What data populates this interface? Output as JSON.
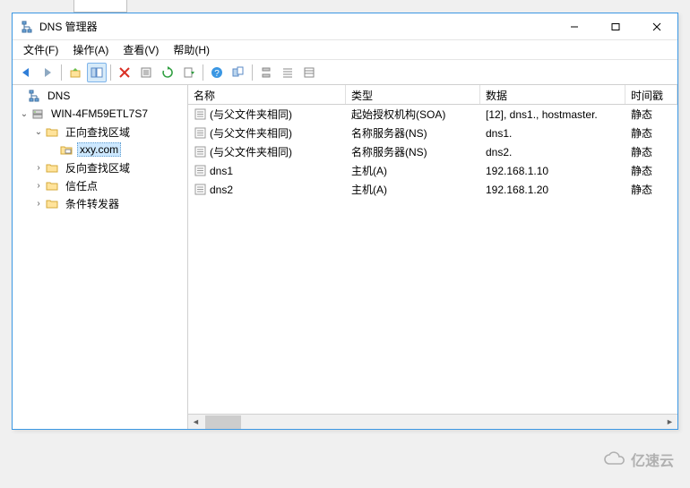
{
  "window": {
    "title": "DNS 管理器"
  },
  "menu": {
    "file": "文件(F)",
    "action": "操作(A)",
    "view": "查看(V)",
    "help": "帮助(H)"
  },
  "tree": {
    "root": "DNS",
    "server": "WIN-4FM59ETL7S7",
    "fwd_zone": "正向查找区域",
    "selected_zone": "xxy.com",
    "rev_zone": "反向查找区域",
    "trust": "信任点",
    "cond_fwd": "条件转发器"
  },
  "columns": {
    "name": "名称",
    "type": "类型",
    "data": "数据",
    "timestamp": "时间戳"
  },
  "records": [
    {
      "name": "(与父文件夹相同)",
      "type": "起始授权机构(SOA)",
      "data": "[12], dns1., hostmaster.",
      "ts": "静态"
    },
    {
      "name": "(与父文件夹相同)",
      "type": "名称服务器(NS)",
      "data": "dns1.",
      "ts": "静态"
    },
    {
      "name": "(与父文件夹相同)",
      "type": "名称服务器(NS)",
      "data": "dns2.",
      "ts": "静态"
    },
    {
      "name": "dns1",
      "type": "主机(A)",
      "data": "192.168.1.10",
      "ts": "静态"
    },
    {
      "name": "dns2",
      "type": "主机(A)",
      "data": "192.168.1.20",
      "ts": "静态"
    }
  ],
  "watermark": "亿速云"
}
